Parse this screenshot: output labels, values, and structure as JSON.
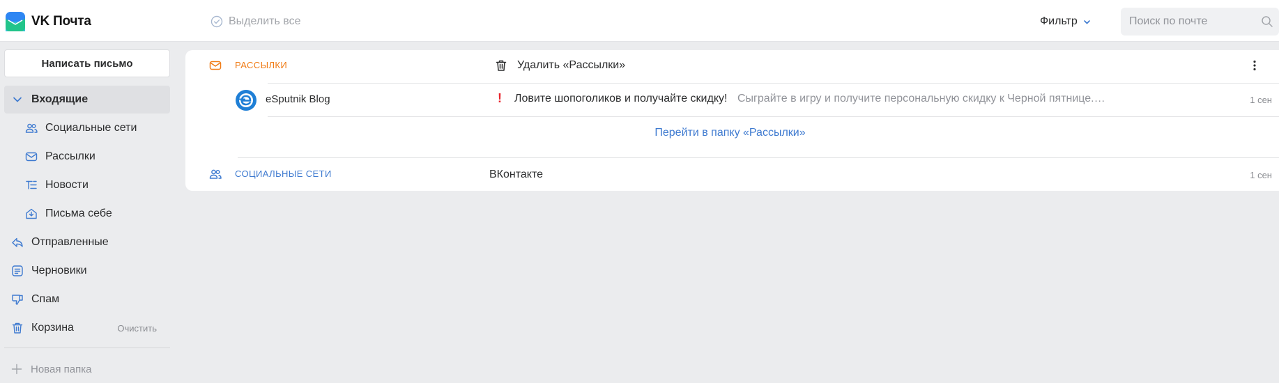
{
  "app": {
    "title": "VK Почта",
    "logo_icon": "vk-mail-logo"
  },
  "toolbar": {
    "select_all_label": "Выделить все",
    "filter_label": "Фильтр",
    "search_placeholder": "Поиск по почте"
  },
  "sidebar": {
    "compose_label": "Написать письмо",
    "items": [
      {
        "label": "Входящие",
        "icon": "chevron-down-icon",
        "active": true
      },
      {
        "label": "Социальные сети",
        "icon": "people-icon"
      },
      {
        "label": "Рассылки",
        "icon": "envelope-icon"
      },
      {
        "label": "Новости",
        "icon": "news-list-icon"
      },
      {
        "label": "Письма себе",
        "icon": "inbox-self-icon"
      },
      {
        "label": "Отправленные",
        "icon": "sent-icon"
      },
      {
        "label": "Черновики",
        "icon": "drafts-icon"
      },
      {
        "label": "Спам",
        "icon": "thumb-down-icon"
      },
      {
        "label": "Корзина",
        "icon": "trash-icon",
        "action": "Очистить"
      }
    ],
    "new_folder_label": "Новая папка"
  },
  "main": {
    "categories": [
      {
        "label": "Рассылки",
        "action_label": "Удалить «Рассылки»",
        "color": "#f07b15",
        "emails": [
          {
            "sender": "eSputnik Blog",
            "important_mark": "!",
            "subject": "Ловите шопоголиков и получайте скидку!",
            "snippet": "Сыграйте в игру и получите персональную скидку к Черной пятнице. Сколько зевак вы смо...",
            "time": "1 сен"
          }
        ],
        "goto_label": "Перейти в папку «Рассылки»"
      },
      {
        "label": "Социальные сети",
        "color": "#3e7ad0",
        "sender": "ВКонтакте",
        "time": "1 сен"
      }
    ]
  },
  "colors": {
    "accent_blue": "#3e7ad0",
    "accent_orange": "#f07b15",
    "important_red": "#e8242c",
    "background": "#ebecee"
  }
}
